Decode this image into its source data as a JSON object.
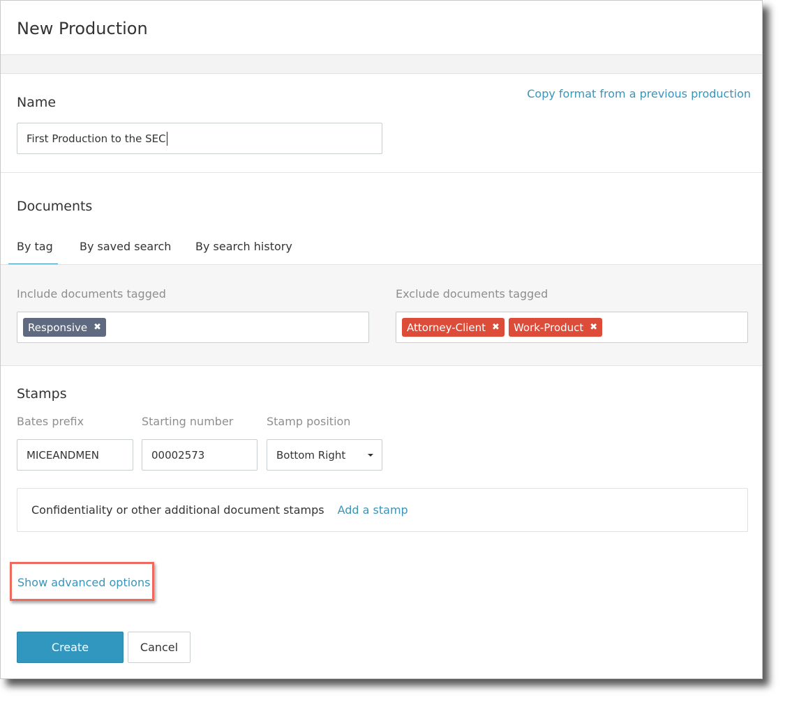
{
  "dialog": {
    "title": "New Production",
    "copy_format_link": "Copy format from a previous production"
  },
  "name_section": {
    "label": "Name",
    "value": "First Production to the SEC"
  },
  "documents": {
    "label": "Documents",
    "tabs": [
      {
        "label": "By tag",
        "active": true
      },
      {
        "label": "By saved search",
        "active": false
      },
      {
        "label": "By search history",
        "active": false
      }
    ],
    "include": {
      "label": "Include documents tagged",
      "tags": [
        {
          "label": "Responsive",
          "color": "#5f6980"
        }
      ]
    },
    "exclude": {
      "label": "Exclude documents tagged",
      "tags": [
        {
          "label": "Attorney-Client",
          "color": "#dd4b39"
        },
        {
          "label": "Work-Product",
          "color": "#dd4b39"
        }
      ]
    }
  },
  "stamps": {
    "label": "Stamps",
    "bates_prefix": {
      "label": "Bates prefix",
      "value": "MICEANDMEN"
    },
    "starting_number": {
      "label": "Starting number",
      "value": "00002573"
    },
    "stamp_position": {
      "label": "Stamp position",
      "value": "Bottom Right"
    },
    "additional": {
      "text": "Confidentiality or other additional document stamps",
      "link": "Add a stamp"
    }
  },
  "advanced_link": "Show advanced options",
  "buttons": {
    "create": "Create",
    "cancel": "Cancel"
  },
  "colors": {
    "accent": "#3a94b8",
    "primary_button": "#3197be",
    "highlight": "#ee6a5e"
  }
}
